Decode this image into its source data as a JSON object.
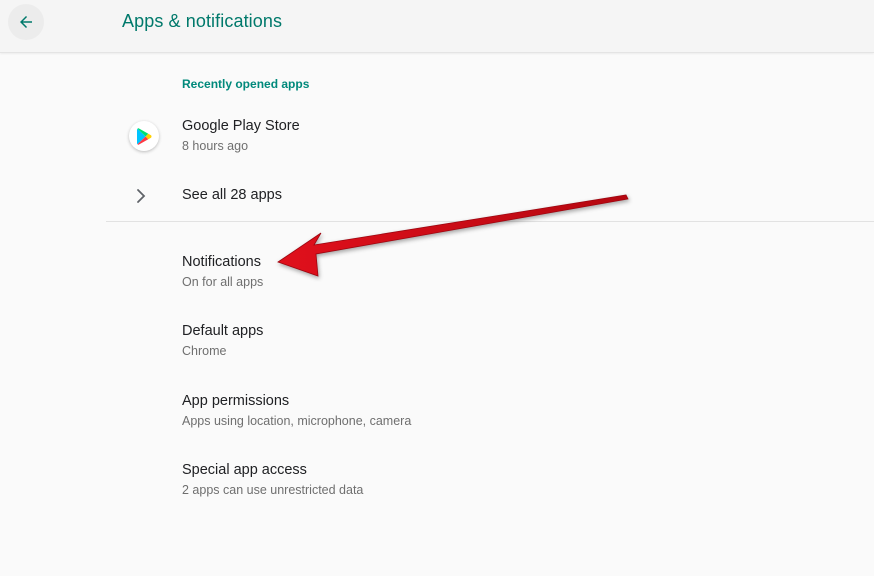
{
  "header": {
    "title": "Apps & notifications",
    "accent_color": "#00796b"
  },
  "recent": {
    "section_label": "Recently opened apps",
    "apps": [
      {
        "name": "Google Play Store",
        "subtitle": "8 hours ago",
        "icon": "google-play-icon"
      }
    ],
    "see_all_label": "See all 28 apps"
  },
  "settings": {
    "items": [
      {
        "title": "Notifications",
        "subtitle": "On for all apps"
      },
      {
        "title": "Default apps",
        "subtitle": "Chrome"
      },
      {
        "title": "App permissions",
        "subtitle": "Apps using location, microphone, camera"
      },
      {
        "title": "Special app access",
        "subtitle": "2 apps can use unrestricted data"
      }
    ]
  },
  "annotation": {
    "arrow_color": "#cc0a14",
    "points_to": "Notifications"
  }
}
